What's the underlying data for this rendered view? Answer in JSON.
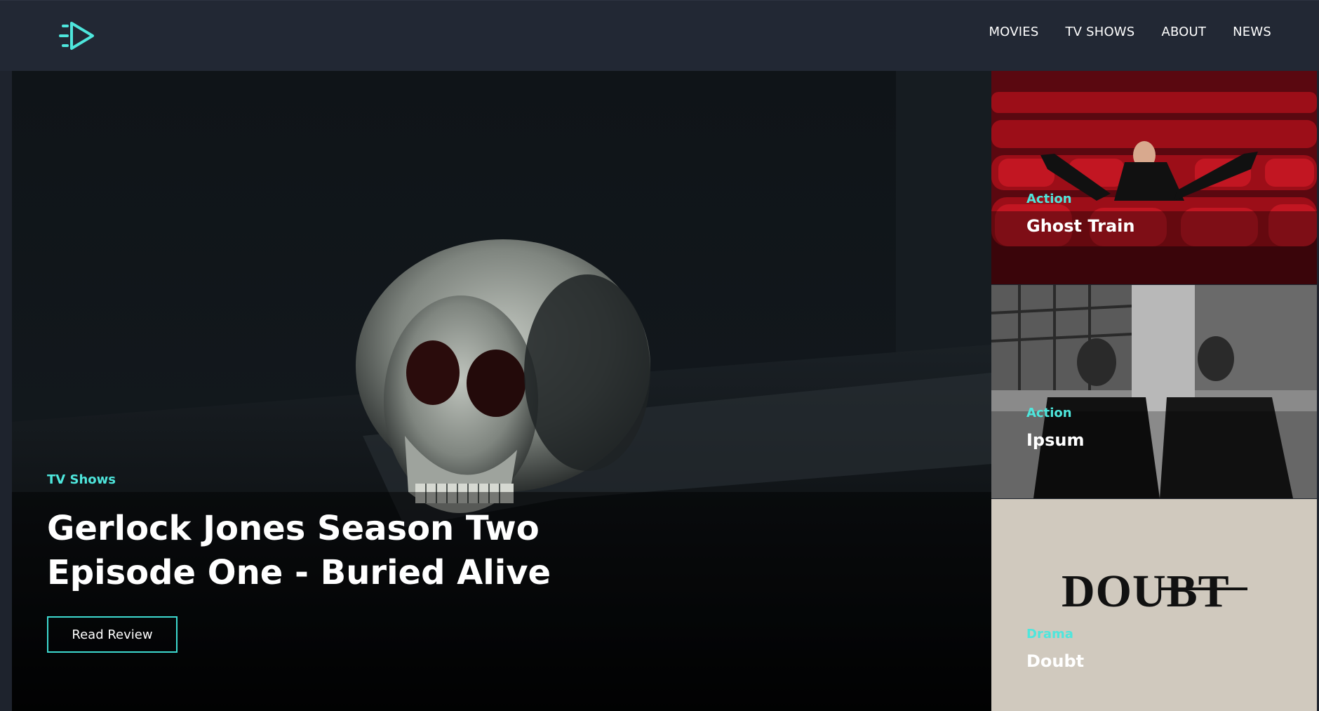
{
  "nav": {
    "logo_icon": "play-arrow-logo-icon",
    "items": [
      {
        "label": "MOVIES"
      },
      {
        "label": "TV SHOWS"
      },
      {
        "label": "ABOUT"
      },
      {
        "label": "NEWS"
      }
    ]
  },
  "hero": {
    "category": "TV Shows",
    "title": "Gerlock Jones Season Two Episode One - Buried Alive",
    "button_label": "Read Review"
  },
  "cards": [
    {
      "category": "Action",
      "title": "Ghost Train"
    },
    {
      "category": "Action",
      "title": "Ipsum"
    },
    {
      "category": "Drama",
      "title": "Doubt",
      "poster_text": "DOUBT"
    }
  ],
  "colors": {
    "accent": "#4ee6dc",
    "header_bg": "#222834",
    "page_bg": "#1e232d"
  }
}
